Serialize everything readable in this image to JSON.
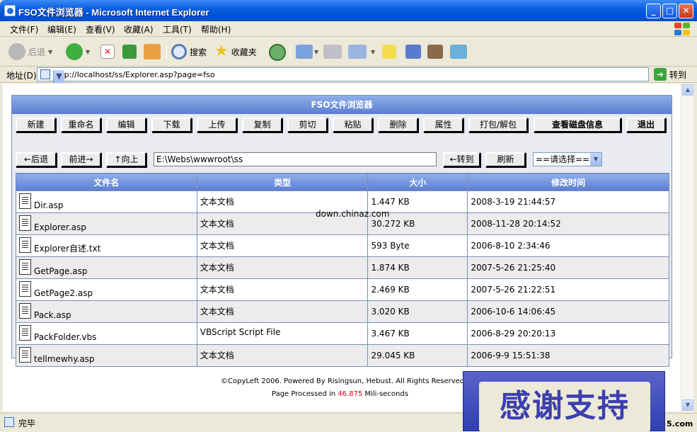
{
  "window": {
    "title": "FSO文件浏览器 - Microsoft Internet Explorer",
    "min": "_",
    "max": "□",
    "close": "✕"
  },
  "menu": [
    "文件(F)",
    "编辑(E)",
    "查看(V)",
    "收藏(A)",
    "工具(T)",
    "帮助(H)"
  ],
  "toolbar": {
    "back": "后退",
    "search": "搜索",
    "favorites": "收藏夹"
  },
  "address": {
    "label": "地址(D)",
    "url": "http://localhost/ss/Explorer.asp?page=fso",
    "go": "转到"
  },
  "panel": {
    "title": "FSO文件浏览器"
  },
  "actions": [
    "新建",
    "重命名",
    "编辑",
    "下载",
    "上传",
    "复制",
    "剪切",
    "粘贴",
    "删除",
    "属性",
    "打包/解包",
    "查看磁盘信息",
    "退出"
  ],
  "nav": {
    "back": "←后退",
    "forward": "前进→",
    "up": "↑向上",
    "path": "E:\\Webs\\wwwroot\\ss",
    "goto": "←转到",
    "refresh": "刷新",
    "select": "==请选择=="
  },
  "table": {
    "headers": [
      "文件名",
      "类型",
      "大小",
      "修改时间"
    ],
    "rows": [
      {
        "name": "Dir.asp",
        "type": "文本文档",
        "size": "1.447 KB",
        "date": "2008-3-19 21:44:57"
      },
      {
        "name": "Explorer.asp",
        "type": "文本文档",
        "size": "30.272 KB",
        "date": "2008-11-28 20:14:52"
      },
      {
        "name": "Explorer自述.txt",
        "type": "文本文档",
        "size": "593 Byte",
        "date": "2006-8-10 2:34:46"
      },
      {
        "name": "GetPage.asp",
        "type": "文本文档",
        "size": "1.874 KB",
        "date": "2007-5-26 21:25:40"
      },
      {
        "name": "GetPage2.asp",
        "type": "文本文档",
        "size": "2.469 KB",
        "date": "2007-5-26 21:22:51"
      },
      {
        "name": "Pack.asp",
        "type": "文本文档",
        "size": "3.020 KB",
        "date": "2006-10-6 14:06:45"
      },
      {
        "name": "PackFolder.vbs",
        "type": "VBScript Script File",
        "size": "3.467 KB",
        "date": "2006-8-29 20:20:13"
      },
      {
        "name": "tellmewhy.asp",
        "type": "文本文档",
        "size": "29.045 KB",
        "date": "2006-9-9 15:51:38"
      }
    ]
  },
  "footer": {
    "line1": "©CopyLeft 2006. Powered By Risingsun, Hebust. All Rights Reserved",
    "line2_pre": "Page Processed in",
    "line2_num": "46.875",
    "line2_post": "Mili-seconds"
  },
  "watermark": "down.chinaz.com",
  "status": "完毕",
  "banner": "感谢支持",
  "corner": "5.com"
}
